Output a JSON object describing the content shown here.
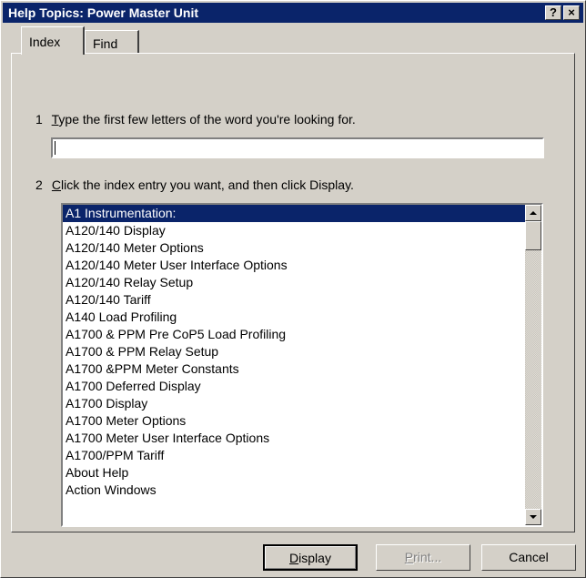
{
  "window": {
    "title": "Help Topics: Power Master Unit",
    "help_glyph": "?",
    "close_glyph": "×"
  },
  "tabs": [
    {
      "label": "Index",
      "selected": true
    },
    {
      "label": "Find",
      "selected": false
    }
  ],
  "step1": {
    "number": "1",
    "text_pre": "",
    "mnemonic": "T",
    "text_post": "ype the first few letters of the word you're looking for."
  },
  "search": {
    "value": "",
    "placeholder": ""
  },
  "step2": {
    "number": "2",
    "mnemonic": "C",
    "text_post": "lick the index entry you want, and then click Display."
  },
  "index_list": {
    "selected_index": 0,
    "items": [
      "A1  Instrumentation:",
      "A120/140 Display",
      "A120/140 Meter Options",
      "A120/140 Meter User Interface Options",
      "A120/140 Relay Setup",
      "A120/140 Tariff",
      "A140 Load Profiling",
      "A1700 & PPM Pre CoP5 Load Profiling",
      "A1700 & PPM Relay Setup",
      "A1700 &PPM Meter Constants",
      "A1700 Deferred Display",
      "A1700 Display",
      "A1700 Meter Options",
      "A1700 Meter User Interface Options",
      "A1700/PPM Tariff",
      "About Help",
      "Action Windows"
    ]
  },
  "buttons": {
    "display": {
      "mnemonic": "D",
      "rest": "isplay"
    },
    "print": {
      "mnemonic": "P",
      "rest": "rint..."
    },
    "cancel": {
      "label": "Cancel"
    }
  },
  "colors": {
    "titlebar": "#0a246a",
    "face": "#d4d0c8",
    "selection": "#0a246a"
  }
}
